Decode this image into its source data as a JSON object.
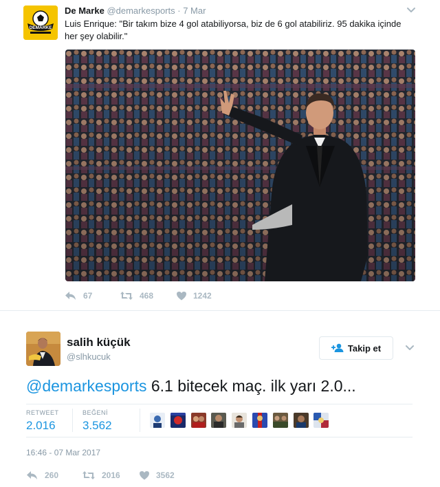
{
  "tweet1": {
    "account_name": "De Marke",
    "handle": "@demarkesports",
    "separator": "·",
    "date": "7 Mar",
    "avatar_logo_text": "DEMARKE",
    "text": "Luis Enrique: \"Bir takım bize 4 gol atabiliyorsa, biz de 6 gol atabiliriz. 95 dakika içinde her şey olabilir.\"",
    "actions": {
      "replies": "67",
      "retweets": "468",
      "likes": "1242"
    }
  },
  "tweet2": {
    "account_name": "salih küçük",
    "handle": "@slhkucuk",
    "follow_label": "Takip et",
    "mention": "@demarkesports",
    "text": " 6.1 bitecek maç. ilk yarı 2.0...",
    "stats": {
      "retweet_label": "RETWEET",
      "retweet_value": "2.016",
      "like_label": "BEĞENİ",
      "like_value": "3.562"
    },
    "liker_avatar_count": 9,
    "timestamp": "16:46 - 07 Mar 2017",
    "actions": {
      "replies": "260",
      "retweets": "2016",
      "likes": "3562"
    }
  },
  "colors": {
    "link_blue": "#1b95e0",
    "muted_gray": "#8899a6",
    "icon_gray": "#aab8c2",
    "brand_yellow": "#f5c400"
  }
}
